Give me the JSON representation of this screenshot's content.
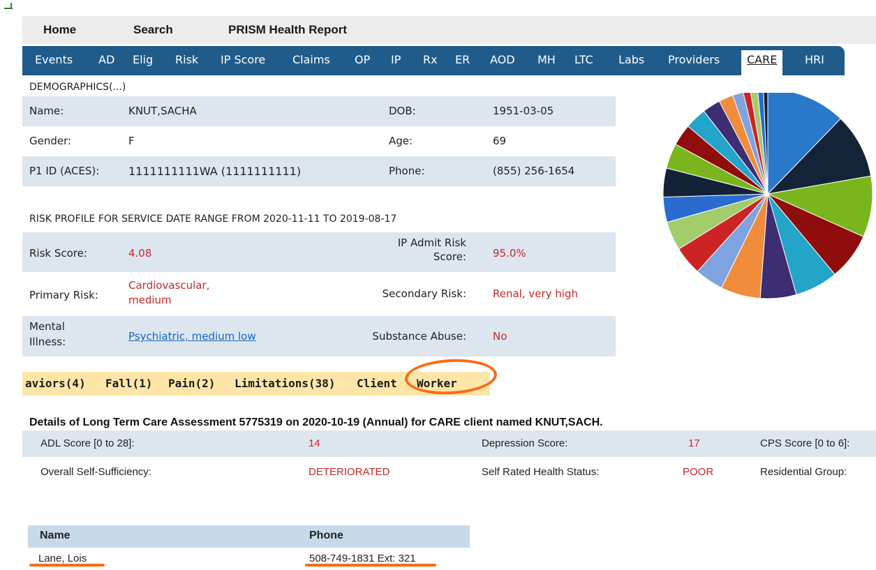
{
  "top_menu": {
    "home": "Home",
    "search": "Search",
    "report": "PRISM Health Report"
  },
  "tabs": [
    "Events",
    "AD",
    "Elig",
    "Risk",
    "IP Score",
    "Claims",
    "OP",
    "IP",
    "Rx",
    "ER",
    "AOD",
    "MH",
    "LTC",
    "Labs",
    "Providers",
    "CARE",
    "HRI"
  ],
  "active_tab": "CARE",
  "demographics": {
    "title": "DEMOGRAPHICS(...)",
    "name_label": "Name:",
    "name": "KNUT,SACHA",
    "dob_label": "DOB:",
    "dob": "1951-03-05",
    "gender_label": "Gender:",
    "gender": "F",
    "age_label": "Age:",
    "age": "69",
    "p1_label": "P1 ID (ACES):",
    "p1": "1111111111WA (1111111111)",
    "phone_label": "Phone:",
    "phone": "(855) 256-1654"
  },
  "risk": {
    "title": "RISK PROFILE FOR SERVICE DATE RANGE FROM 2020-11-11 TO 2019-08-17",
    "score_label": "Risk Score:",
    "score": "4.08",
    "ip_label_line1": "IP Admit Risk",
    "ip_label_line2": "Score:",
    "ip": "95.0%",
    "primary_label": "Primary Risk:",
    "primary_line1": "Cardiovascular,",
    "primary_line2": "medium",
    "secondary_label": "Secondary Risk:",
    "secondary": "Renal, very high",
    "mental_label_line1": "Mental",
    "mental_label_line2": "Illness:",
    "mental": "Psychiatric, medium low",
    "substance_label": "Substance Abuse:",
    "substance": "No"
  },
  "subtabs": [
    "aviors(4)",
    "Fall(1)",
    "Pain(2)",
    "Limitations(38)",
    "Client",
    "Worker"
  ],
  "details": {
    "title": "Details of Long Term Care Assessment 5775319 on 2020-10-19 (Annual) for CARE client named KNUT,SACH.",
    "adl_label": "ADL Score [0 to 28]:",
    "adl": "14",
    "depression_label": "Depression Score:",
    "depression": "17",
    "cps_label": "CPS Score [0 to 6]:",
    "self_suff_label": "Overall Self-Sufficiency:",
    "self_suff": "DETERIORATED",
    "health_label": "Self Rated Health Status:",
    "health": "POOR",
    "residential_label": "Residential Group:"
  },
  "worker_table": {
    "headers": [
      "Name",
      "Phone"
    ],
    "rows": [
      {
        "name": "Lane, Lois",
        "phone": "508-749-1831 Ext: 321"
      }
    ]
  },
  "colors": {
    "tab_bar": "#1f5c8c",
    "row_shade": "#dde6ef",
    "subtab_bg": "#ffe6a8",
    "risk_red": "#c62828",
    "annotation_orange": "#ff6a13"
  },
  "chart_data": {
    "type": "pie",
    "slices": [
      {
        "value": 11.0,
        "color": "#2a78c9"
      },
      {
        "value": 9.0,
        "color": "#142438"
      },
      {
        "value": 8.5,
        "color": "#7bb51e"
      },
      {
        "value": 6.5,
        "color": "#8f0d0d"
      },
      {
        "value": 6.0,
        "color": "#23a4c9"
      },
      {
        "value": 5.0,
        "color": "#3d2d73"
      },
      {
        "value": 5.5,
        "color": "#f08c3c"
      },
      {
        "value": 4.0,
        "color": "#7fa3e0"
      },
      {
        "value": 4.0,
        "color": "#cc2424"
      },
      {
        "value": 4.0,
        "color": "#a3cc6a"
      },
      {
        "value": 3.5,
        "color": "#2a6bd1"
      },
      {
        "value": 4.0,
        "color": "#132236"
      },
      {
        "value": 3.5,
        "color": "#7bb51e"
      },
      {
        "value": 3.0,
        "color": "#8f0d0d"
      },
      {
        "value": 3.0,
        "color": "#23a4c9"
      },
      {
        "value": 2.5,
        "color": "#3d2d73"
      },
      {
        "value": 2.0,
        "color": "#f08c3c"
      },
      {
        "value": 1.5,
        "color": "#7fa3e0"
      },
      {
        "value": 1.0,
        "color": "#cc2424"
      },
      {
        "value": 1.0,
        "color": "#a3cc6a"
      },
      {
        "value": 0.8,
        "color": "#2a6bd1"
      },
      {
        "value": 0.6,
        "color": "#132236"
      }
    ]
  }
}
